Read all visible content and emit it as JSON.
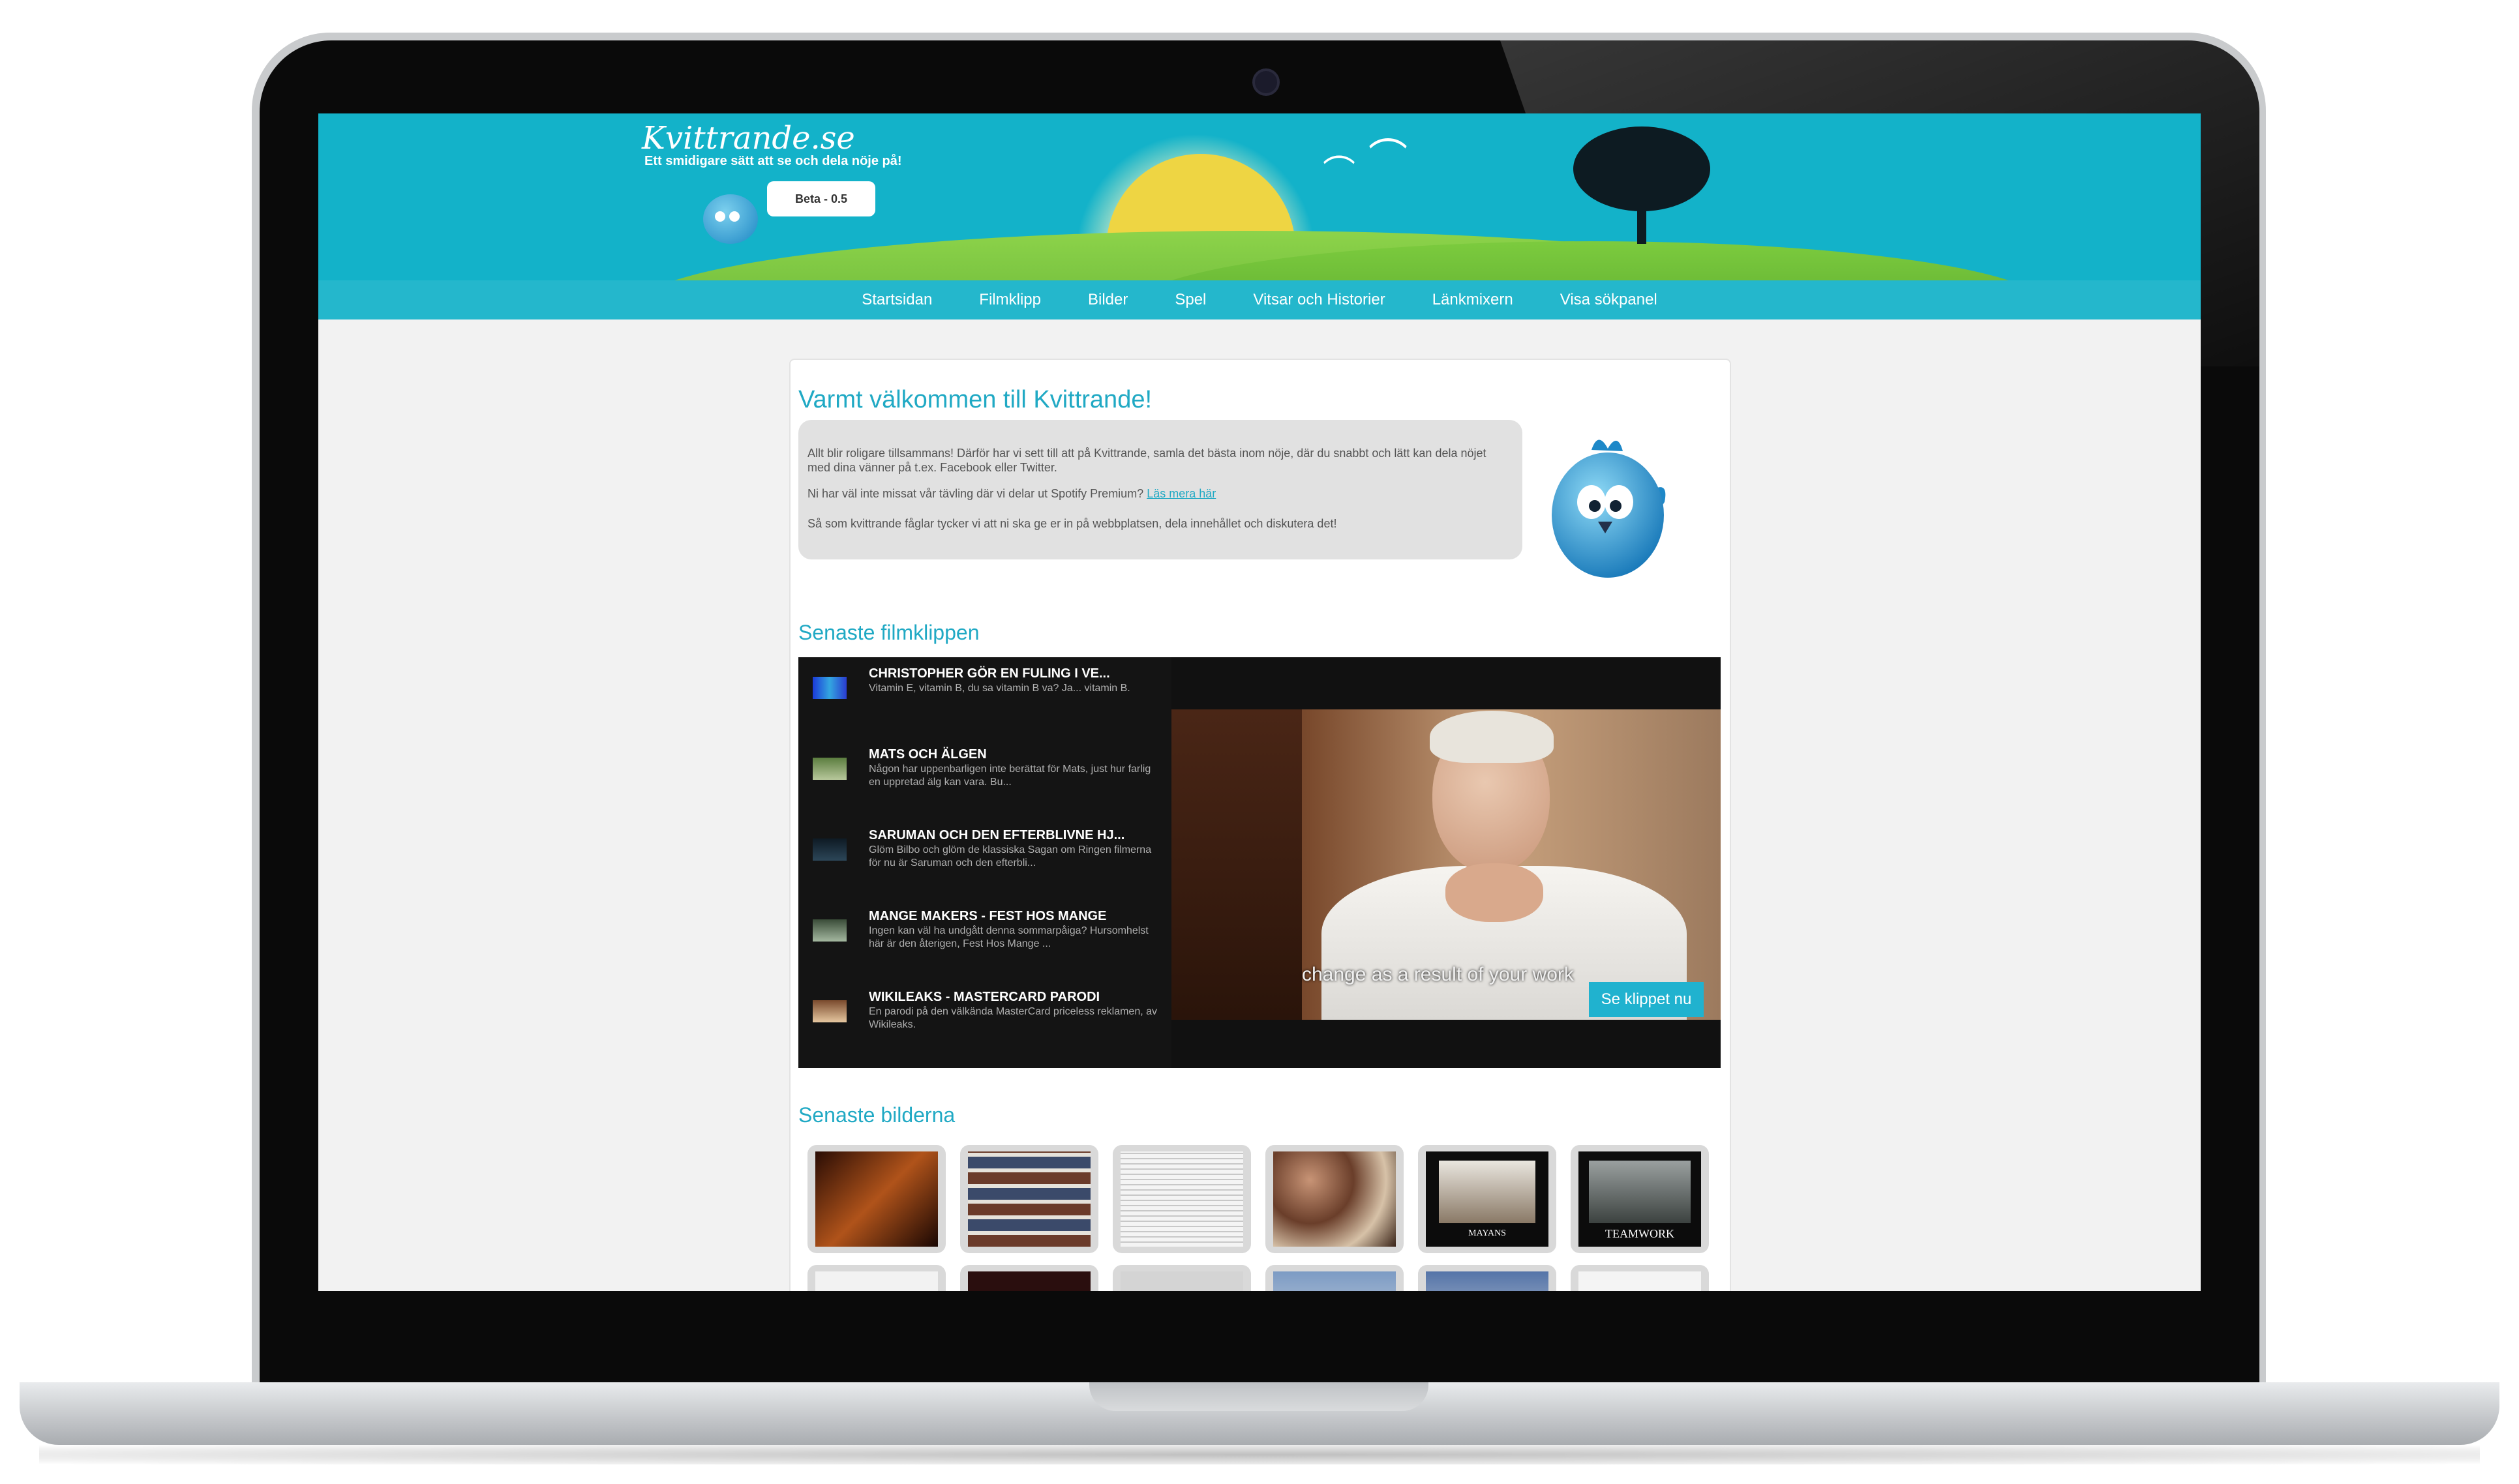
{
  "site": {
    "logo": "Kvittrande.se",
    "tagline": "Ett smidigare sätt att se och dela nöje på!",
    "beta": "Beta - 0.5"
  },
  "nav": [
    "Startsidan",
    "Filmklipp",
    "Bilder",
    "Spel",
    "Vitsar och Historier",
    "Länkmixern",
    "Visa sökpanel"
  ],
  "welcome": {
    "title": "Varmt välkommen till Kvittrande!",
    "p1": "Allt blir roligare tillsammans! Därför har vi sett till att på Kvittrande, samla det bästa inom nöje, där du snabbt och lätt kan dela nöjet med dina vänner på t.ex. Facebook eller Twitter.",
    "p2_text": "Ni har väl inte missat vår tävling där vi delar ut Spotify Premium?",
    "p2_link": "Läs mera här",
    "p3": "Så som kvittrande fåglar tycker vi att ni ska ge er in på webbplatsen, dela innehållet och diskutera det!"
  },
  "videos": {
    "heading": "Senaste filmklippen",
    "items": [
      {
        "title": "CHRISTOPHER GÖR EN FULING I VE...",
        "desc": "Vitamin E, vitamin B, du sa vitamin B va? Ja... vitamin B."
      },
      {
        "title": "MATS OCH ÄLGEN",
        "desc": "Någon har uppenbarligen inte berättat för Mats, just hur farlig en uppretad älg kan vara. Bu..."
      },
      {
        "title": "SARUMAN OCH DEN EFTERBLIVNE HJ...",
        "desc": "Glöm Bilbo och glöm de klassiska Sagan om Ringen filmerna för nu är Saruman och den efterbli..."
      },
      {
        "title": "MANGE MAKERS - FEST HOS MANGE",
        "desc": "Ingen kan väl ha undgått denna sommarpåiga? Hursomhelst här är den återigen, Fest Hos Mange ..."
      },
      {
        "title": "WIKILEAKS - MASTERCARD PARODI",
        "desc": "En parodi på den välkända MasterCard priceless reklamen, av Wikileaks."
      }
    ],
    "subtitle": "change as a result of your work",
    "cta": "Se klippet nu"
  },
  "images": {
    "heading": "Senaste bilderna",
    "captions": [
      "MAYANS",
      "TEAMWORK"
    ]
  },
  "colors": {
    "accent": "#20a9c4",
    "banner": "#13b2c9",
    "nav": "#24b7cc"
  }
}
